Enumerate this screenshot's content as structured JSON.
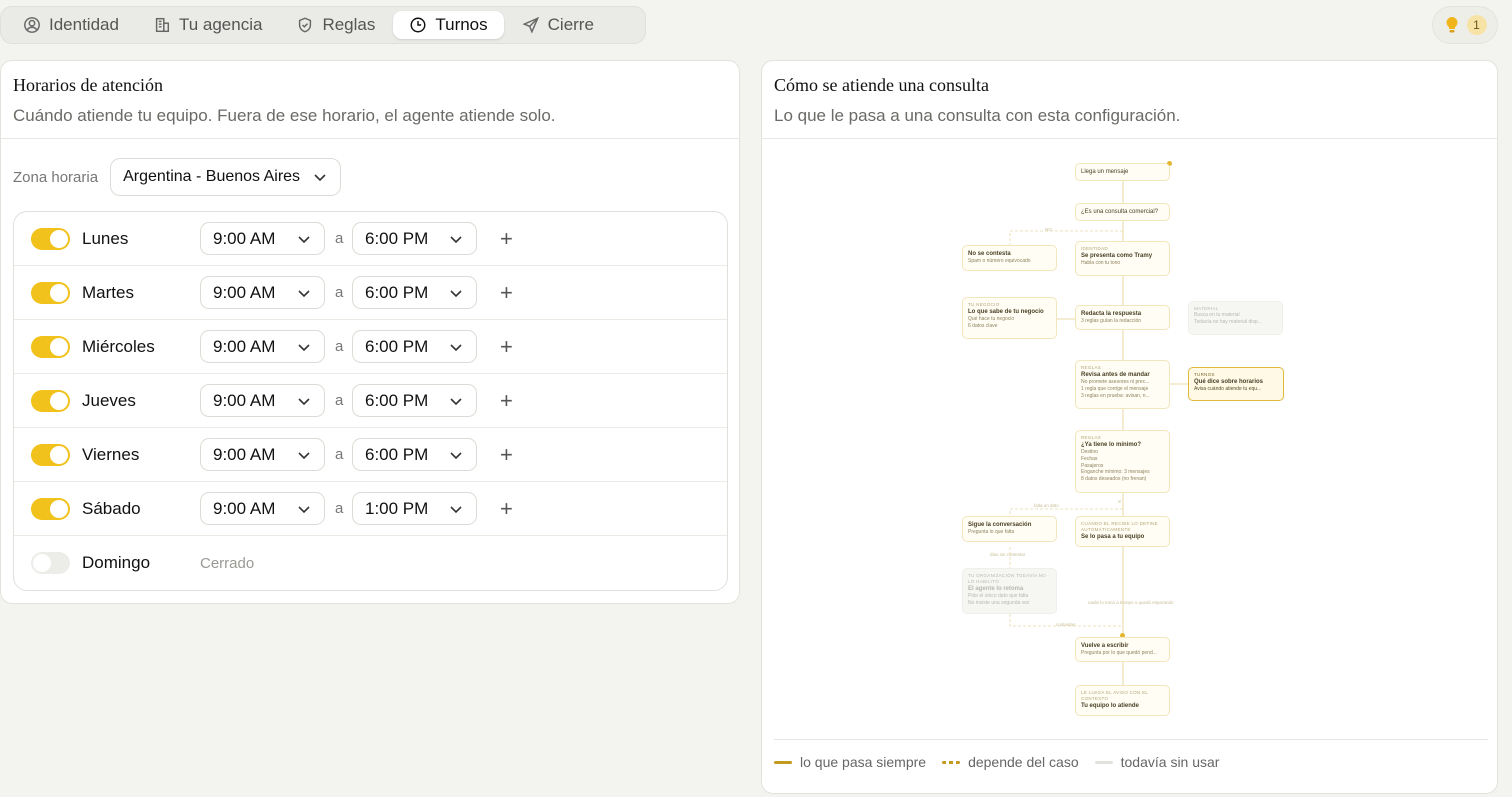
{
  "tabs": [
    {
      "label": "Identidad",
      "icon": "user-circle-icon"
    },
    {
      "label": "Tu agencia",
      "icon": "building-icon"
    },
    {
      "label": "Reglas",
      "icon": "shield-icon"
    },
    {
      "label": "Turnos",
      "icon": "clock-icon",
      "active": true
    },
    {
      "label": "Cierre",
      "icon": "send-icon"
    }
  ],
  "tips": {
    "icon": "lightbulb-icon",
    "count": "1"
  },
  "schedule_card": {
    "title": "Horarios de atención",
    "subtitle": "Cuándo atiende tu equipo. Fuera de ese horario, el agente atiende solo.",
    "timezone_label": "Zona horaria",
    "timezone_value": "Argentina - Buenos Aires",
    "separator": "a",
    "days": [
      {
        "name": "Lunes",
        "enabled": true,
        "from": "9:00 AM",
        "to": "6:00 PM"
      },
      {
        "name": "Martes",
        "enabled": true,
        "from": "9:00 AM",
        "to": "6:00 PM"
      },
      {
        "name": "Miércoles",
        "enabled": true,
        "from": "9:00 AM",
        "to": "6:00 PM"
      },
      {
        "name": "Jueves",
        "enabled": true,
        "from": "9:00 AM",
        "to": "6:00 PM"
      },
      {
        "name": "Viernes",
        "enabled": true,
        "from": "9:00 AM",
        "to": "6:00 PM"
      },
      {
        "name": "Sábado",
        "enabled": true,
        "from": "9:00 AM",
        "to": "1:00 PM"
      },
      {
        "name": "Domingo",
        "enabled": false,
        "closed_label": "Cerrado"
      }
    ]
  },
  "flow_card": {
    "title": "Cómo se atiende una consulta",
    "subtitle": "Lo que le pasa a una consulta con esta configuración.",
    "nodes": {
      "n1": {
        "title": "Llega un mensaje"
      },
      "n2": {
        "title": "¿Es una consulta comercial?"
      },
      "n3": {
        "title": "No se contesta",
        "lines": [
          "Spam o número equivocado"
        ]
      },
      "n4": {
        "label": "Identidad",
        "title": "Se presenta como Tramy",
        "lines": [
          "Habla con tu tono"
        ]
      },
      "n5": {
        "label": "Tu negocio",
        "title": "Lo que sabe de tu negocio",
        "lines": [
          "Qué hace tu negocio",
          "6 datos clave"
        ]
      },
      "n6": {
        "title": "Redacta la respuesta",
        "lines": [
          "3 reglas guían la redacción"
        ]
      },
      "n7": {
        "label": "Material",
        "title": "",
        "lines": [
          "Busca en tu material",
          "Todavía no hay material disp..."
        ]
      },
      "n8": {
        "label": "Reglas",
        "title": "Revisa antes de mandar",
        "lines": [
          "No promete asesores ni prec...",
          "1 regla que corrige el mensaje",
          "3 reglas en prueba: avisan, n..."
        ]
      },
      "n9": {
        "label": "Turnos",
        "title": "Qué dice sobre horarios",
        "lines": [
          "Avisa cuándo atiende tu equ..."
        ]
      },
      "n10": {
        "label": "Reglas",
        "title": "¿Ya tiene lo mínimo?",
        "lines": [
          "Destino",
          "Fechas",
          "Pasajeros",
          "Enganche mínimo: 3 mensajes",
          "8 datos deseados (no frenan)"
        ]
      },
      "n11": {
        "title": "Sigue la conversación",
        "lines": [
          "Pregunta lo que falta"
        ]
      },
      "n12": {
        "label": "Cuando el recibe lo define automáticamente",
        "title": "Se lo pasa a tu equipo"
      },
      "n13": {
        "label": "Tu organización todavía no lo habilitó",
        "title": "El agente lo retoma",
        "lines": [
          "Pide el único dato que falta",
          "No insiste una segunda vez"
        ]
      },
      "n14": {
        "title": "Vuelve a escribir",
        "lines": [
          "Pregunta por lo que quedó pend..."
        ]
      },
      "n15": {
        "label": "Le llega el aviso con el contexto",
        "title": "Tu equipo lo atiende"
      }
    },
    "edge_labels": {
      "no": "NO",
      "falta": "falta un dato",
      "si": "sí",
      "sin_contestar": "días sin contestar",
      "espera": "nadie lo tomó a tiempo o quedó esperando",
      "contestan": "contestan"
    },
    "legend": [
      {
        "label": "lo que pasa siempre",
        "style": "solid"
      },
      {
        "label": "depende del caso",
        "style": "dash"
      },
      {
        "label": "todavía sin usar",
        "style": "gray"
      }
    ]
  }
}
